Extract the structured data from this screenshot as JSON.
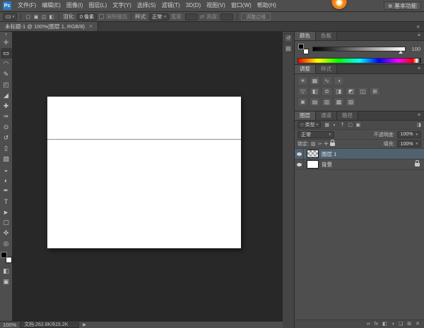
{
  "colors": {
    "panel": "#4e4e4e",
    "panel_dark": "#3c3c3c",
    "canvas": "#282828",
    "border": "#2a2a2a",
    "text": "#d6d6d6",
    "text_dim": "#9a9a9a",
    "selection": "#50616f",
    "logo_blue": "#2d7abf",
    "badge_orange": "#f58220"
  },
  "ui": {
    "caret_icon": "▾",
    "grid_icon": "▦",
    "funnel_icon": "▽"
  },
  "app": {
    "logo_text": "Ps",
    "menu_items": [
      "文件(F)",
      "编辑(E)",
      "图像(I)",
      "图层(L)",
      "文字(Y)",
      "选择(S)",
      "滤镜(T)",
      "3D(D)",
      "视图(V)",
      "窗口(W)",
      "帮助(H)"
    ],
    "workspace_button": "基本功能"
  },
  "dock": {
    "collapse_icon": "«"
  },
  "options_bar": {
    "tool_icon": "▭",
    "mode_icons": [
      {
        "id": "new-selection-icon",
        "glyph": "▢"
      },
      {
        "id": "add-selection-icon",
        "glyph": "▣"
      },
      {
        "id": "subtract-selection-icon",
        "glyph": "◫"
      },
      {
        "id": "intersect-selection-icon",
        "glyph": "◧"
      }
    ],
    "feather_label": "羽化:",
    "feather_value": "0 像素",
    "antialias_label": "消除锯齿",
    "style_label": "样式:",
    "style_value": "正常",
    "width_label": "宽度:",
    "width_value": "",
    "swap_icon": "⇄",
    "height_label": "高度:",
    "height_value": "",
    "refine_edge_button": "调整边缘"
  },
  "document_tab": {
    "title": "未标题-1 @ 100%(图层 1, RGB/8)",
    "close_icon": "×"
  },
  "toolbar": {
    "collapse_icon": "«",
    "tools": [
      {
        "id": "move-tool",
        "glyph": "✛"
      },
      {
        "id": "rect-marquee-tool",
        "glyph": "▭",
        "active": true
      },
      {
        "id": "lasso-tool",
        "glyph": "◠"
      },
      {
        "id": "quick-selection-tool",
        "glyph": "✎"
      },
      {
        "id": "crop-tool",
        "glyph": "◰"
      },
      {
        "id": "eyedropper-tool",
        "glyph": "◢"
      },
      {
        "id": "healing-brush-tool",
        "glyph": "✚"
      },
      {
        "id": "brush-tool",
        "glyph": "✑"
      },
      {
        "id": "clone-stamp-tool",
        "glyph": "⊙"
      },
      {
        "id": "history-brush-tool",
        "glyph": "↺"
      },
      {
        "id": "eraser-tool",
        "glyph": "▯"
      },
      {
        "id": "gradient-tool",
        "glyph": "▧"
      },
      {
        "id": "blur-tool",
        "glyph": "◒"
      },
      {
        "id": "dodge-tool",
        "glyph": "◐"
      },
      {
        "id": "pen-tool",
        "glyph": "✒"
      },
      {
        "id": "type-tool",
        "glyph": "T"
      },
      {
        "id": "path-selection-tool",
        "glyph": "►"
      },
      {
        "id": "rect-shape-tool",
        "glyph": "▢"
      },
      {
        "id": "hand-tool",
        "glyph": "✜"
      },
      {
        "id": "zoom-tool",
        "glyph": "◎"
      }
    ],
    "quick_mask_icon": "◧",
    "screen_mode_icon": "▣"
  },
  "mini_dock": {
    "icons": [
      {
        "id": "history-panel-icon",
        "glyph": "↺"
      },
      {
        "id": "properties-panel-icon",
        "glyph": "▤"
      }
    ]
  },
  "color_panel": {
    "tabs": [
      "颜色",
      "色板"
    ],
    "panel_menu_icon": "≡",
    "slider_value": "100"
  },
  "adjustments_panel": {
    "tabs": [
      "调整",
      "样式"
    ],
    "rows": [
      [
        {
          "id": "brightness-contrast-icon",
          "glyph": "☀"
        },
        {
          "id": "levels-icon",
          "glyph": "▦"
        },
        {
          "id": "curves-icon",
          "glyph": "∿"
        },
        {
          "id": "exposure-icon",
          "glyph": "◑"
        }
      ],
      [
        {
          "id": "vibrance-icon",
          "glyph": "▽"
        },
        {
          "id": "hue-saturation-icon",
          "glyph": "◧"
        },
        {
          "id": "color-balance-icon",
          "glyph": "⊜"
        },
        {
          "id": "black-white-icon",
          "glyph": "◨"
        },
        {
          "id": "photo-filter-icon",
          "glyph": "◩"
        },
        {
          "id": "channel-mixer-icon",
          "glyph": "◫"
        },
        {
          "id": "color-lookup-icon",
          "glyph": "⊞"
        }
      ],
      [
        {
          "id": "invert-icon",
          "glyph": "◙"
        },
        {
          "id": "posterize-icon",
          "glyph": "▤"
        },
        {
          "id": "threshold-icon",
          "glyph": "▥"
        },
        {
          "id": "gradient-map-icon",
          "glyph": "▩"
        },
        {
          "id": "selective-color-icon",
          "glyph": "▨"
        }
      ]
    ]
  },
  "layers_panel": {
    "tabs": [
      "图层",
      "通道",
      "路径"
    ],
    "panel_menu_icon": "≡",
    "filter_label": "类型",
    "filter_icons": [
      {
        "id": "filter-pixel-layers-icon",
        "glyph": "▦"
      },
      {
        "id": "filter-adjustment-layers-icon",
        "glyph": "◐"
      },
      {
        "id": "filter-type-layers-icon",
        "glyph": "T"
      },
      {
        "id": "filter-shape-layers-icon",
        "glyph": "▢"
      },
      {
        "id": "filter-smart-objects-icon",
        "glyph": "▣"
      }
    ],
    "filter_toggle_icon": "◨",
    "blend_mode": "正常",
    "opacity_label": "不透明度:",
    "opacity_value": "100%",
    "lock_label": "锁定:",
    "lock_icons": [
      {
        "id": "lock-transparency-icon",
        "glyph": "▨"
      },
      {
        "id": "lock-pixels-icon",
        "glyph": "✑"
      },
      {
        "id": "lock-position-icon",
        "glyph": "✛"
      }
    ],
    "fill_label": "填充:",
    "fill_value": "100%",
    "layers": [
      {
        "name": "图层 1",
        "selected": true,
        "thumb": "checker",
        "locked": false
      },
      {
        "name": "背景",
        "selected": false,
        "thumb": "white",
        "locked": true
      }
    ],
    "bottom_icons": [
      {
        "id": "link-layers-icon",
        "glyph": "∞"
      },
      {
        "id": "layer-effects-icon",
        "glyph": "fx"
      },
      {
        "id": "add-layer-mask-icon",
        "glyph": "◧"
      },
      {
        "id": "new-adjustment-layer-icon",
        "glyph": "◑"
      },
      {
        "id": "new-group-icon",
        "glyph": "❏"
      },
      {
        "id": "new-layer-icon",
        "glyph": "⊞"
      },
      {
        "id": "delete-layer-icon",
        "glyph": "✕"
      }
    ]
  },
  "status_bar": {
    "zoom": "100%",
    "doc_info": "文档:262.8K/615.2K",
    "expand_icon": "▶"
  }
}
